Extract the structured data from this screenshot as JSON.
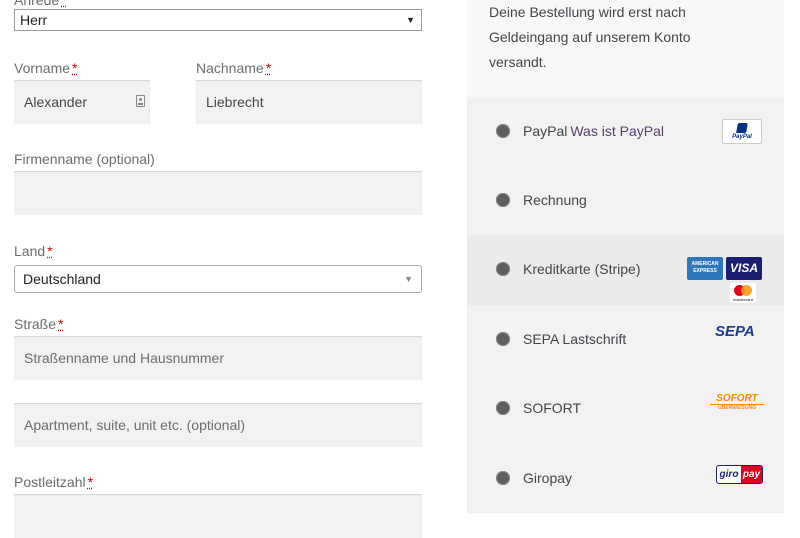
{
  "form": {
    "salutation": {
      "label": "Anrede",
      "value": "Herr"
    },
    "firstname": {
      "label": "Vorname",
      "value": "Alexander"
    },
    "lastname": {
      "label": "Nachname",
      "value": "Liebrecht"
    },
    "company": {
      "label": "Firmenname (optional)",
      "value": ""
    },
    "country": {
      "label": "Land",
      "value": "Deutschland"
    },
    "street": {
      "label": "Straße",
      "placeholder": "Straßenname und Hausnummer"
    },
    "apartment": {
      "placeholder": "Apartment, suite, unit etc. (optional)"
    },
    "postcode": {
      "label": "Postleitzahl",
      "value": ""
    },
    "required_mark": "*"
  },
  "payment": {
    "info_lines": [
      "Deine Bestellung wird erst nach",
      "Geldeingang auf unserem Konto",
      "versandt."
    ],
    "methods": [
      {
        "label": "PayPal",
        "link": "Was ist PayPal",
        "icon": "paypal-logo"
      },
      {
        "label": "Rechnung"
      },
      {
        "label": "Kreditkarte (Stripe)",
        "icon": "credit-card-logos",
        "selected": true
      },
      {
        "label": "SEPA Lastschrift",
        "icon": "sepa-logo"
      },
      {
        "label": "SOFORT",
        "icon": "sofort-logo"
      },
      {
        "label": "Giropay",
        "icon": "giropay-logo"
      }
    ],
    "logos": {
      "paypal": "PayPal",
      "amex_top": "AMERICAN",
      "amex_bottom": "EXPRESS",
      "visa": "VISA",
      "mastercard": "mastercard",
      "sepa": "SEPA",
      "sofort_top": "SOFORT",
      "sofort_bottom": "ÜBERWEISUNG",
      "giro": "giro",
      "pay": "pay"
    },
    "colors": {
      "link": "#5b3e6e",
      "paypal_blue": "#003087",
      "visa_blue": "#1a1f71",
      "amex_blue": "#2e77bc",
      "sofort_orange": "#ef8c00",
      "giro_red": "#e2001a"
    }
  }
}
